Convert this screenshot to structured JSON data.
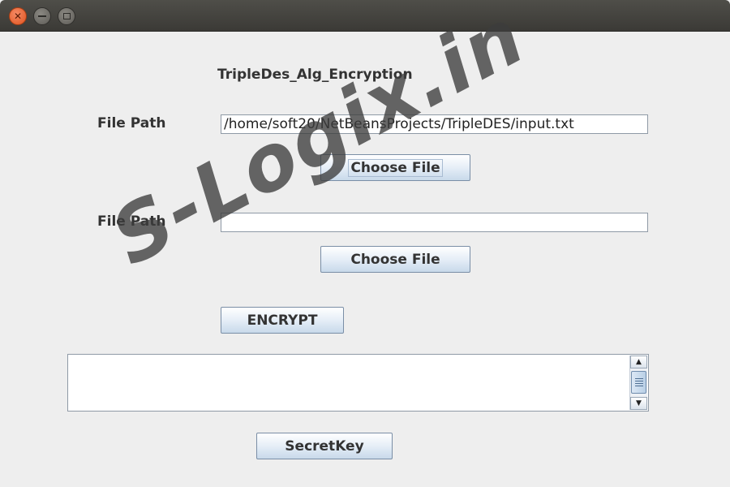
{
  "window": {
    "controls": {
      "close_icon": "close-icon",
      "minimize_icon": "minimize-icon",
      "maximize_icon": "maximize-icon"
    }
  },
  "form": {
    "heading": "TripleDes_Alg_Encryption",
    "file_path_1": {
      "label": "File Path",
      "value": "/home/soft20/NetBeansProjects/TripleDES/input.txt"
    },
    "choose_file_1_label": "Choose File",
    "file_path_2": {
      "label": "File Path",
      "value": ""
    },
    "choose_file_2_label": "Choose File",
    "encrypt_label": "ENCRYPT",
    "output_text": "",
    "secret_key_label": "SecretKey"
  },
  "watermark": {
    "text": "S-Logix.in"
  },
  "colors": {
    "window_bg": "#eeeeee",
    "titlebar_bg": "#3e3d39",
    "close_button": "#e9602b",
    "button_border": "#7a8ea6",
    "text": "#333333"
  }
}
